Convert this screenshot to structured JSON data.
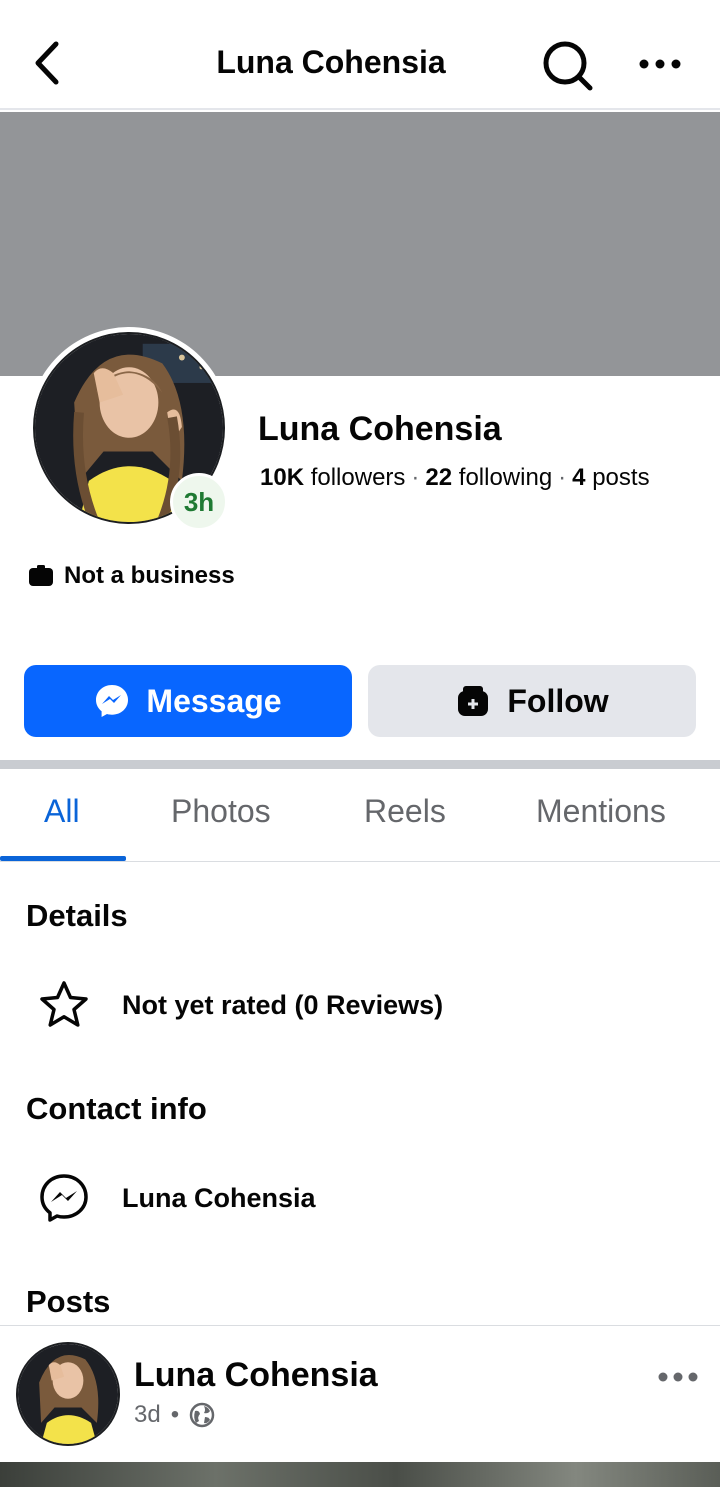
{
  "topbar": {
    "title": "Luna Cohensia",
    "icons": [
      "back-arrow-icon",
      "search-icon",
      "more-options-icon"
    ]
  },
  "profile": {
    "name": "Luna Cohensia",
    "story_badge": "3h",
    "stats": {
      "followers_count": "10K",
      "followers_label": "followers",
      "following_count": "22",
      "following_label": "following",
      "posts_count": "4",
      "posts_label": "posts",
      "separator": "·"
    },
    "category": "Not a business"
  },
  "actions": {
    "message_label": "Message",
    "follow_label": "Follow"
  },
  "tabs": [
    {
      "label": "All",
      "active": true
    },
    {
      "label": "Photos",
      "active": false
    },
    {
      "label": "Reels",
      "active": false
    },
    {
      "label": "Mentions",
      "active": false
    }
  ],
  "details": {
    "title": "Details",
    "rating_text": "Not yet rated (0 Reviews)"
  },
  "contact": {
    "title": "Contact info",
    "messenger_name": "Luna Cohensia"
  },
  "posts": {
    "title": "Posts",
    "items": [
      {
        "author": "Luna Cohensia",
        "time": "3d",
        "separator": "•",
        "audience_icon": "globe-icon"
      }
    ]
  },
  "colors": {
    "accent": "#0866ff",
    "tab_active": "#0a64d8",
    "cover": "#939598",
    "follow_bg": "#e4e6eb",
    "story_text": "#1f7a33"
  }
}
